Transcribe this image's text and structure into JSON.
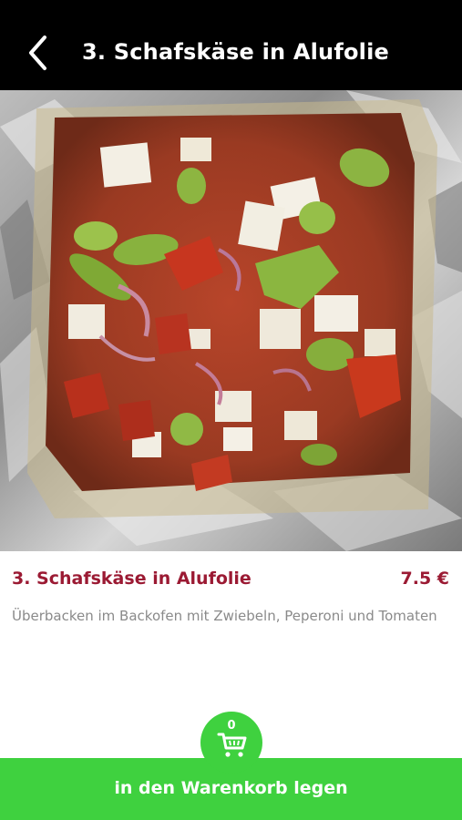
{
  "header": {
    "title": "3. Schafskäse in Alufolie",
    "back_icon": "chevron-left-icon"
  },
  "product": {
    "image_alt": "Schafskäse in Alufolie",
    "title": "3. Schafskäse in Alufolie",
    "price": "7.5 €",
    "description": "Überbacken im Backofen mit Zwiebeln, Peperoni und Tomaten"
  },
  "cart": {
    "count": "0",
    "icon": "shopping-cart-icon",
    "button_label": "in den Warenkorb legen"
  },
  "colors": {
    "header_bg": "#000000",
    "accent_red": "#9b1a33",
    "cart_green": "#3fd13f",
    "description_gray": "#8a8a8a"
  }
}
